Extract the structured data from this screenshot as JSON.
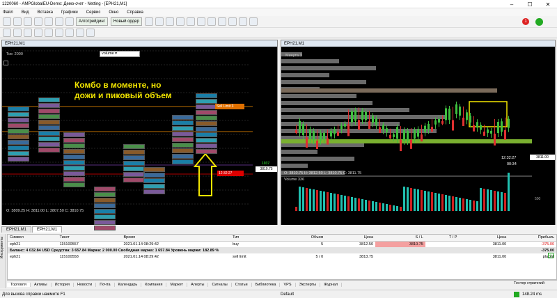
{
  "window": {
    "title": "1220060 - AMPGlobalEU-Demo: Демо-счет - Netting - [EPH21,M1]"
  },
  "menu": [
    "Файл",
    "Вид",
    "Вставка",
    "Графики",
    "Сервис",
    "Окно",
    "Справка"
  ],
  "toolbar": {
    "algo": "Алготрейдинг",
    "new_order": "Новый ордер"
  },
  "left_chart": {
    "title": "EPH21,M1",
    "tick_label": "Тик: 2000",
    "volume_select": "volume",
    "annotation_line1": "Комбо в моменте, но",
    "annotation_line2": "дожи и пиковый объем",
    "ohlc": "O: 3809.25  H: 3811.00  L: 3807.50  C: 3810.75",
    "sell_limit_label": "Sell Limit  3",
    "price_axis": [
      "3816.00",
      "3815.00",
      "3814.00",
      "3813.75",
      "3813.00",
      "3812.50",
      "3812.00",
      "3811.00",
      "3810.75",
      "3810.00"
    ],
    "side_counts": [
      "48",
      "38",
      "39",
      "43",
      "29",
      "25",
      "26",
      "31",
      "30",
      "33",
      "35",
      "25",
      "31"
    ],
    "time_axis": [
      "05:52",
      "06:45",
      "07:14",
      "07:37",
      "08:02",
      "08:10",
      "2021.01.14 08:21:59"
    ],
    "timer": "12:32:27",
    "volume_badge": "1937",
    "current_price": "3810.75",
    "columns": [
      {
        "cells": [
          "13",
          "161",
          "209",
          "175",
          "217",
          "274",
          "207",
          "141",
          "255",
          "135"
        ]
      },
      {
        "cells": [
          "126",
          "247",
          "135",
          "58",
          "156",
          "327",
          "329",
          "286",
          "137",
          "71"
        ]
      },
      {
        "cells": [
          "2",
          "19",
          "22",
          "30",
          "274",
          "250",
          "208",
          "211",
          "221",
          "301"
        ]
      },
      {
        "cells": [
          "4",
          "77",
          "102",
          "135",
          "171",
          "124",
          "208",
          "126"
        ]
      },
      {
        "cells": [
          "56",
          "101",
          "67",
          "73",
          "434",
          "191",
          "96"
        ]
      },
      {
        "cells": [
          "5",
          "22",
          "122",
          "173",
          "77"
        ]
      },
      {
        "cells": [
          "57",
          "263",
          "257",
          "217",
          "277",
          "210",
          "143",
          "114",
          "52"
        ]
      },
      {
        "cells": [
          "29",
          "136",
          "171",
          "136",
          "147",
          "109",
          "57",
          "67",
          "82",
          "69",
          "65"
        ]
      }
    ]
  },
  "right_chart": {
    "title": "EPH21,M1",
    "label": "Минута  3",
    "ohlc": "O: 3810.75  H: 3812.50  L: 3810.75  C: 3811.75",
    "price_axis": [
      "3815.00",
      "3814.00",
      "3813.00",
      "3812.00",
      "3811.00"
    ],
    "timer": "12:32:27",
    "volume_label": "Volume 336",
    "volume_axis": "500",
    "bid_box": "00:34",
    "current_price": "3811.00",
    "time_axis": [
      "06:18",
      "06:42",
      "07:03",
      "07:23",
      "07:40",
      "08:09",
      "2021.01.14 08:30:00"
    ]
  },
  "chart_tabs": [
    "EPH21,M1",
    "EPH21,M1"
  ],
  "trade_table": {
    "headers": [
      "Символ",
      "Тикет",
      "Время",
      "Тип",
      "Объем",
      "Цена",
      "S / L",
      "T / P",
      "Цена",
      "Прибыль"
    ],
    "rows": [
      [
        "eph21",
        "115100557",
        "2021.01.14 08:29:42",
        "buy",
        "5",
        "3812.50",
        "3810.75",
        "",
        "3811.00",
        "-375.00"
      ],
      [
        "eph21",
        "115100558",
        "2021.01.14 08:29:42",
        "sell limit",
        "5 / 0",
        "3813.75",
        "",
        "",
        "3811.00",
        "placed"
      ]
    ],
    "balance": "Баланс: 4 032.84 USD  Средства: 3 657.84  Маржа: 2 000.00  Свободная маржа: 1 657.84  Уровень маржи: 182.89 %",
    "balance_profit": "-375.00"
  },
  "bottom_tabs": [
    "Торговля",
    "Активы",
    "История",
    "Новости",
    "Почта",
    "Календарь",
    "Компания",
    "Маркет",
    "Алерты",
    "Сигналы",
    "Статьи",
    "Библиотека",
    "VPS",
    "Эксперты",
    "Журнал"
  ],
  "strategy_tester": "Тестер стратегий",
  "toolbox_label": "Инструменты",
  "status": {
    "help": "Для вызова справки нажмите F1",
    "profile": "Default",
    "traffic": "148.24 ms"
  },
  "colors": {
    "buy_candle": "#3fbf3f",
    "sell_candle": "#e03030",
    "annotation": "#f2e500",
    "sl_cell": "#f4a0a0"
  }
}
